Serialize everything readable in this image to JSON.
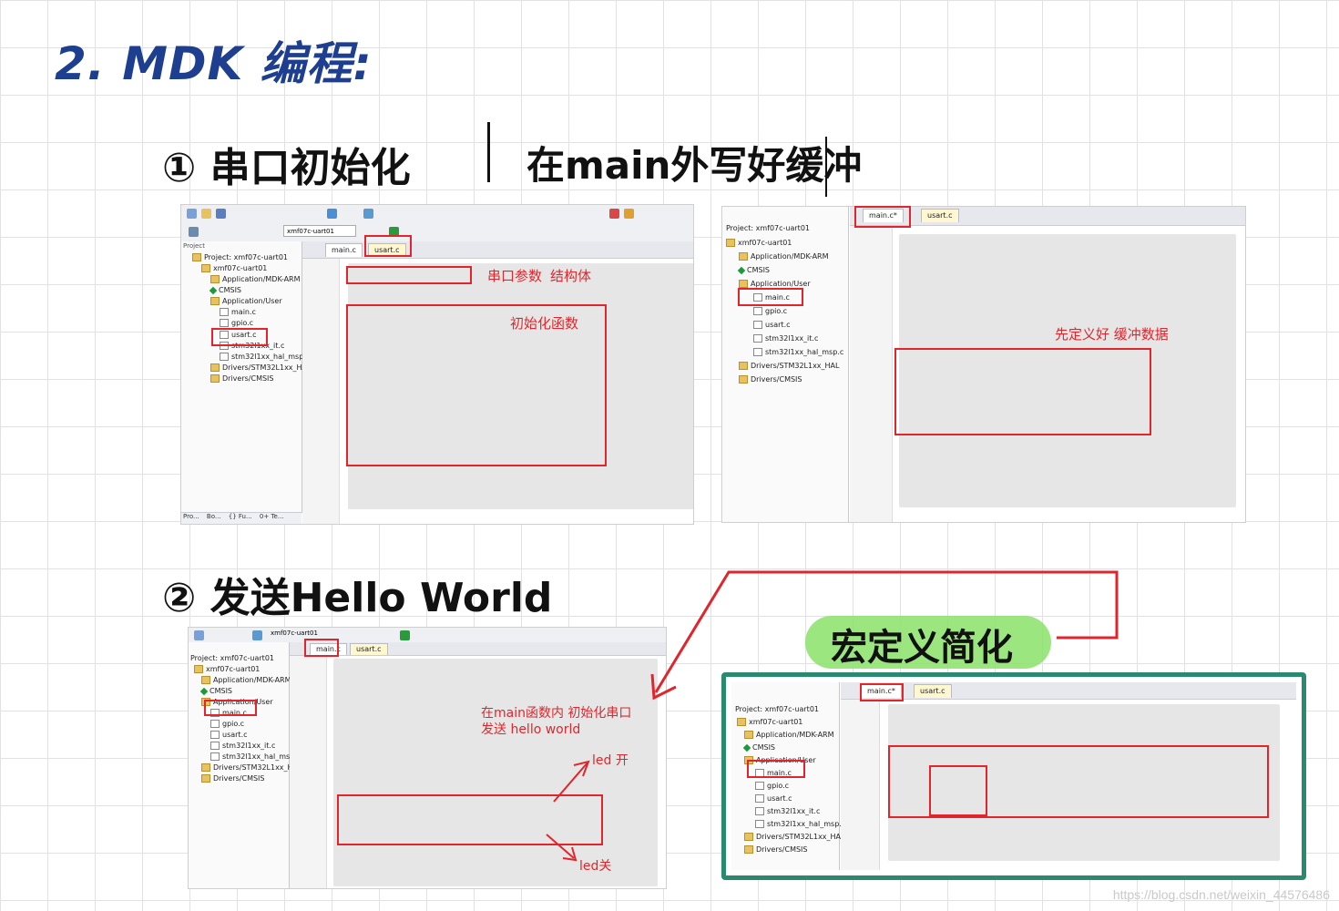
{
  "heading": "2. MDK 编程:",
  "section1": {
    "title_left": "① 串口初始化",
    "title_right": "在main外写好缓冲"
  },
  "section2": {
    "title": "② 发送Hello World",
    "macro_label": "宏定义简化"
  },
  "shot1": {
    "project_header": "Project",
    "target": "xmf07c-uart01",
    "tree": [
      "Project: xmf07c-uart01",
      "xmf07c-uart01",
      "Application/MDK-ARM",
      "CMSIS",
      "Application/User",
      "main.c",
      "gpio.c",
      "usart.c",
      "stm32l1xx_it.c",
      "stm32l1xx_hal_msp.c",
      "Drivers/STM32L1xx_HAL",
      "Drivers/CMSIS"
    ],
    "tabs": [
      "main.c",
      "usart.c"
    ],
    "bottom_tabs": [
      "Pro...",
      "Bo...",
      "{} Fu...",
      "0+ Te..."
    ],
    "annotations": [
      "串口参数",
      "结构体",
      "初始化函数"
    ]
  },
  "shot2": {
    "tree": [
      "Project: xmf07c-uart01",
      "xmf07c-uart01",
      "Application/MDK-ARM",
      "CMSIS",
      "Application/User",
      "main.c",
      "gpio.c",
      "usart.c",
      "stm32l1xx_it.c",
      "stm32l1xx_hal_msp.c",
      "Drivers/STM32L1xx_HAL",
      "Drivers/CMSIS"
    ],
    "tabs": [
      "main.c*",
      "usart.c"
    ],
    "annotations": [
      "先定义好 缓冲数据"
    ]
  },
  "shot3": {
    "target": "xmf07c-uart01",
    "tree": [
      "Project: xmf07c-uart01",
      "xmf07c-uart01",
      "Application/MDK-ARM",
      "CMSIS",
      "Application/User",
      "main.c",
      "gpio.c",
      "usart.c",
      "stm32l1xx_it.c",
      "stm32l1xx_hal_msp.c",
      "Drivers/STM32L1xx_HAL",
      "Drivers/CMSIS"
    ],
    "tabs": [
      "main.c",
      "usart.c"
    ],
    "annotations": [
      "在main函数内 初始化串口",
      "发送 hello world",
      "led 开",
      "led关"
    ]
  },
  "shot4": {
    "tree": [
      "Project: xmf07c-uart01",
      "xmf07c-uart01",
      "Application/MDK-ARM",
      "CMSIS",
      "Application/User",
      "main.c",
      "gpio.c",
      "usart.c",
      "stm32l1xx_it.c",
      "stm32l1xx_hal_msp.c",
      "Drivers/STM32L1xx_HAL",
      "Drivers/CMSIS"
    ],
    "tabs": [
      "main.c*",
      "usart.c"
    ]
  },
  "watermark": "https://blog.csdn.net/weixin_44576486",
  "colors": {
    "annotation_red": "#e0262c",
    "heading_blue": "#1e3f8f",
    "highlight_green": "#8be26a",
    "frame_teal": "#2a8a70"
  }
}
